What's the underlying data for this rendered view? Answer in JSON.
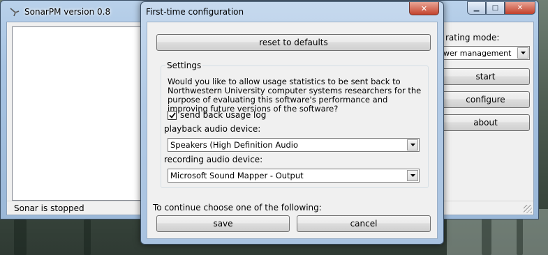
{
  "main_window": {
    "title": "SonarPM version 0.8",
    "status": "Sonar is stopped",
    "mode_label": "rating mode:",
    "mode_value": "wer management",
    "start_label": "start",
    "configure_label": "configure",
    "about_label": "about",
    "minimize_glyph": "▁",
    "maximize_glyph": "□",
    "close_glyph": "✕"
  },
  "dialog": {
    "title": "First-time configuration",
    "close_glyph": "✕",
    "reset_label": "reset to defaults",
    "group_title": "Settings",
    "description": "Would you like to allow usage statistics to be sent back to Northwestern University computer systems researchers for the purpose of evaluating this software's performance and improving future versions of the software?",
    "send_log_label": "send back usage log",
    "send_log_checked": true,
    "playback_label": "playback audio device:",
    "playback_value": "Speakers (High Definition Audio",
    "recording_label": "recording audio device:",
    "recording_value": "Microsoft Sound Mapper - Output",
    "continue_text": "To continue choose one of the following:",
    "save_label": "save",
    "cancel_label": "cancel"
  },
  "icons": {
    "app": "sonar-app-icon",
    "dropdown": "chevron-down-icon",
    "check": "checkmark-icon"
  }
}
